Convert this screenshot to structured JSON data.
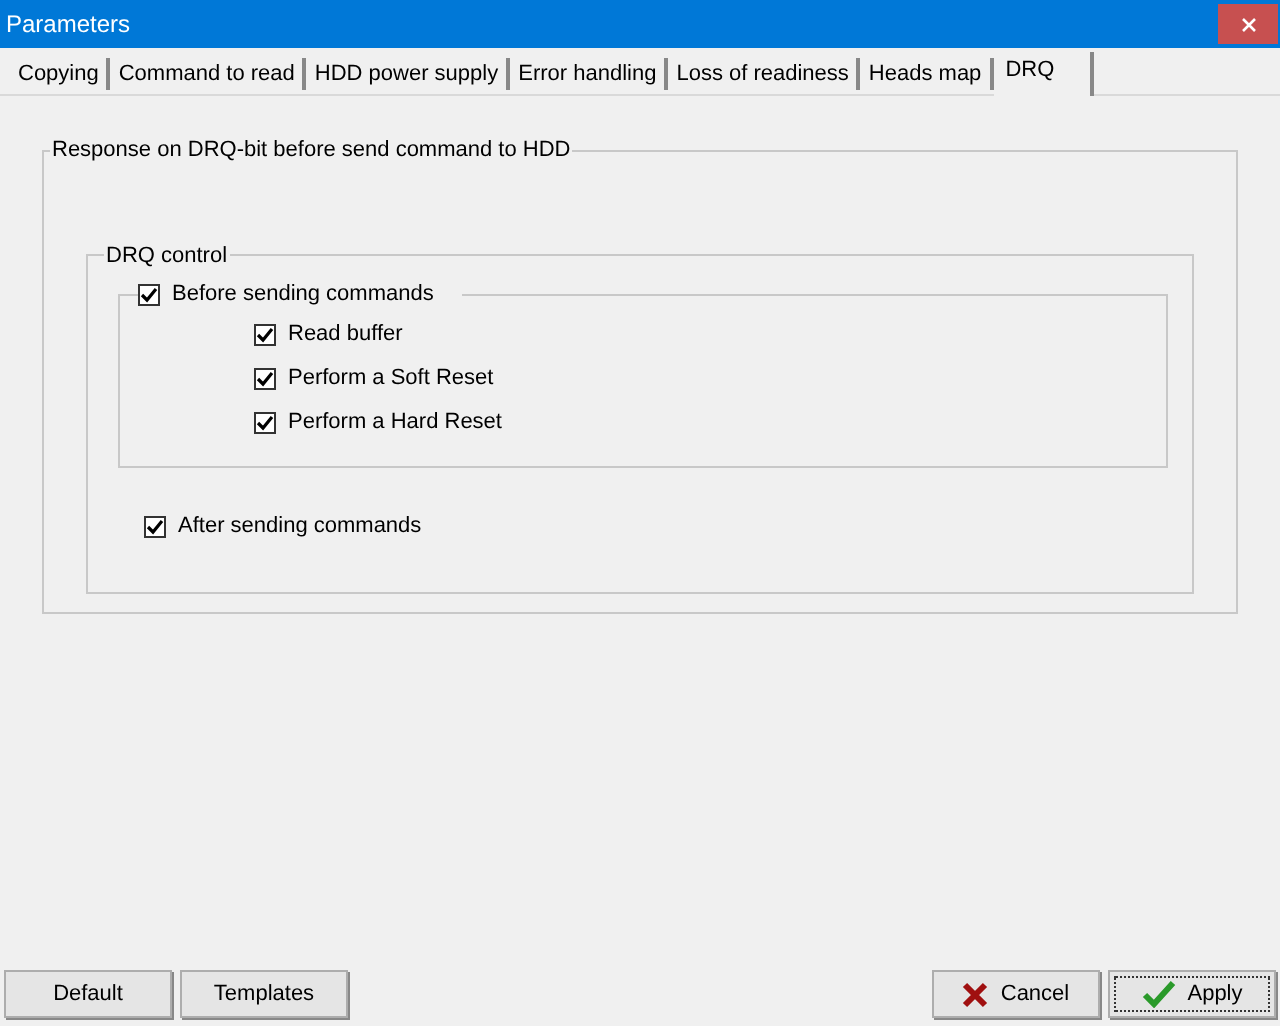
{
  "window": {
    "title": "Parameters"
  },
  "tabs": [
    {
      "label": "Copying",
      "selected": false
    },
    {
      "label": "Command to read",
      "selected": false
    },
    {
      "label": "HDD power supply",
      "selected": false
    },
    {
      "label": "Error handling",
      "selected": false
    },
    {
      "label": "Loss of readiness",
      "selected": false
    },
    {
      "label": "Heads map",
      "selected": false
    },
    {
      "label": "DRQ",
      "selected": true
    }
  ],
  "group": {
    "title": "Response on DRQ-bit before send command to HDD",
    "drq_control": {
      "title": "DRQ control",
      "before": {
        "label": "Before sending commands",
        "checked": true,
        "children": [
          {
            "label": "Read buffer",
            "checked": true
          },
          {
            "label": "Perform a Soft Reset",
            "checked": true
          },
          {
            "label": "Perform a Hard Reset",
            "checked": true
          }
        ]
      },
      "after": {
        "label": "After sending commands",
        "checked": true
      }
    }
  },
  "buttons_left": [
    "Default",
    "Templates"
  ],
  "buttons_right": [
    {
      "kind": "cancel",
      "label": "Cancel"
    },
    {
      "kind": "apply",
      "label": "Apply"
    }
  ]
}
